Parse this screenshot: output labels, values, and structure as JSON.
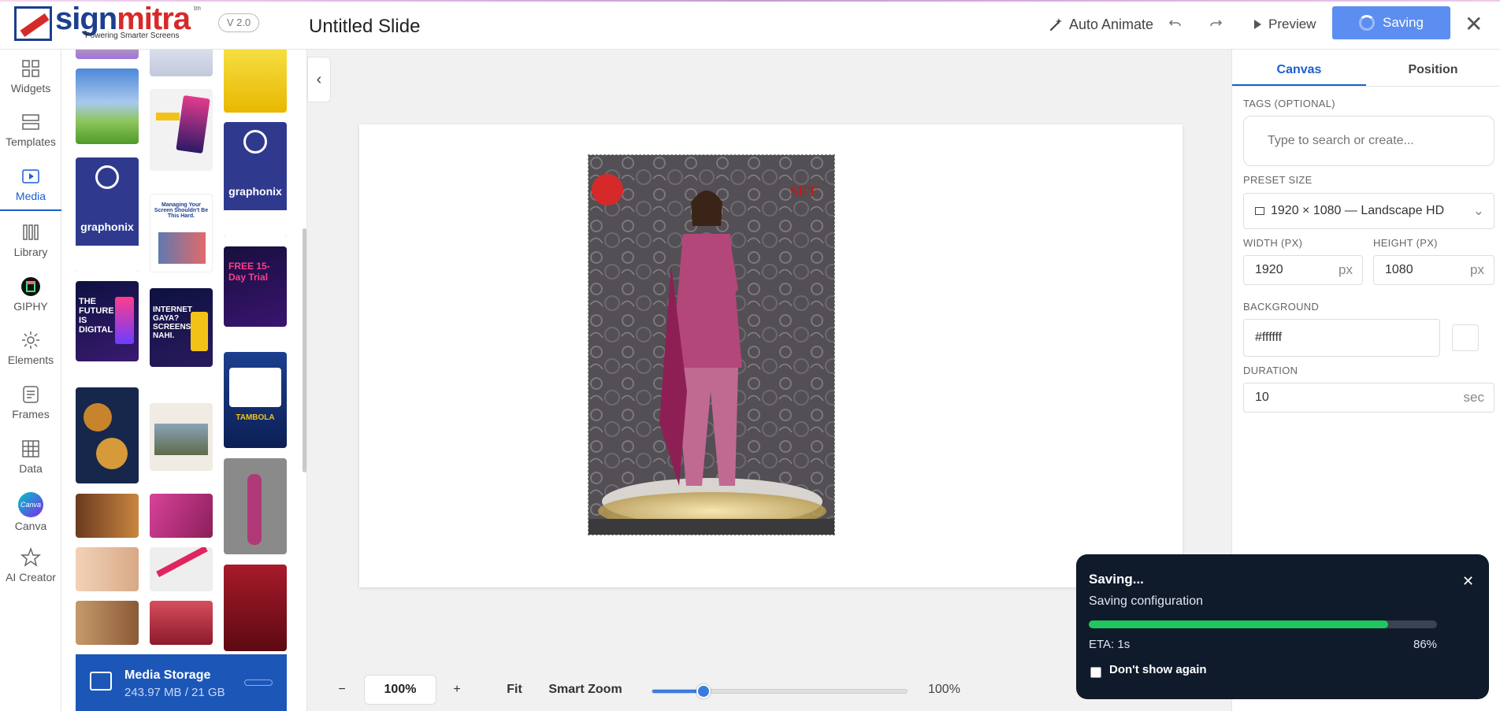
{
  "header": {
    "logo_text_a": "sign",
    "logo_text_b": "mitra",
    "logo_tm": "tm",
    "logo_tagline": "Powering Smarter Screens",
    "version": "V 2.0",
    "title": "Untitled Slide",
    "auto_animate": "Auto Animate",
    "preview": "Preview",
    "saving": "Saving"
  },
  "sidebar": {
    "items": [
      {
        "label": "Widgets",
        "icon": "widgets-icon"
      },
      {
        "label": "Templates",
        "icon": "templates-icon"
      },
      {
        "label": "Media",
        "icon": "media-icon"
      },
      {
        "label": "Library",
        "icon": "library-icon"
      },
      {
        "label": "GIPHY",
        "icon": "giphy-icon"
      },
      {
        "label": "Elements",
        "icon": "elements-icon"
      },
      {
        "label": "Frames",
        "icon": "frames-icon"
      },
      {
        "label": "Data",
        "icon": "data-icon"
      },
      {
        "label": "Canva",
        "icon": "canva-icon"
      },
      {
        "label": "AI Creator",
        "icon": "ai-creator-icon"
      }
    ],
    "canva_badge": "Canva"
  },
  "media": {
    "storage_title": "Media Storage",
    "storage_usage": "243.97 MB / 21 GB",
    "thumb_texts": {
      "graphonix": "graphonix",
      "future": "THE FUTURE IS DIGITAL",
      "internet": "INTERNET GAYA? SCREENS NAHI.",
      "free": "FREE 15-Day Trial",
      "tambola": "TAMBOLA",
      "managing": "Managing Your Screen Shouldn't Be This Hard."
    }
  },
  "canvas": {
    "photo_badge": "SET"
  },
  "zoom": {
    "minus": "−",
    "value": "100%",
    "plus": "+",
    "fit": "Fit",
    "smart_zoom": "Smart Zoom",
    "slider_percent": "100%",
    "slider_fraction": 0.2
  },
  "properties": {
    "tabs": [
      "Canvas",
      "Position"
    ],
    "tags_label": "TAGS (OPTIONAL)",
    "tags_placeholder": "Type to search or create...",
    "preset_label": "PRESET SIZE",
    "preset_value": "1920 × 1080 — Landscape HD",
    "width_label": "WIDTH (PX)",
    "width_value": "1920",
    "height_label": "HEIGHT (PX)",
    "height_value": "1080",
    "px_unit": "px",
    "background_label": "BACKGROUND",
    "background_value": "#ffffff",
    "duration_label": "DURATION",
    "duration_value": "10",
    "duration_unit": "sec"
  },
  "toast": {
    "title": "Saving...",
    "subtitle": "Saving configuration",
    "progress": 86,
    "eta": "ETA: 1s",
    "percent": "86%",
    "dont_show": "Don't show again"
  },
  "colors": {
    "accent": "#1c5fd0",
    "saving_button": "#5b8ef0",
    "progress": "#22c55e",
    "toast_bg": "#0f1a2b"
  }
}
